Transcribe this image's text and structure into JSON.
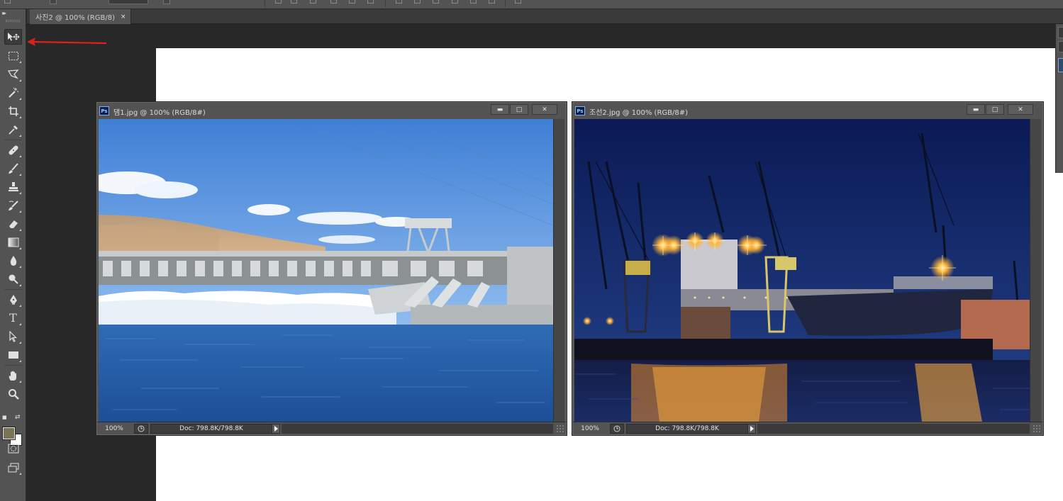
{
  "options_bar": {
    "icons": [
      "checkbox",
      "dropdown",
      "checkbox",
      "align-icons",
      "distribute-icons",
      "arrange-icon"
    ]
  },
  "toolbar": {
    "collapse_glyph": "▸▸",
    "tools": [
      {
        "name": "move-tool",
        "icon": "move-icon",
        "active": true
      },
      {
        "name": "marquee-tool",
        "icon": "rectangular-marquee-icon"
      },
      {
        "name": "lasso-tool",
        "icon": "polygonal-lasso-icon"
      },
      {
        "name": "magic-wand-tool",
        "icon": "magic-wand-icon"
      },
      {
        "name": "crop-tool",
        "icon": "crop-icon"
      },
      {
        "name": "eyedropper-tool",
        "icon": "eyedropper-icon"
      },
      {
        "name": "healing-brush-tool",
        "icon": "bandage-icon"
      },
      {
        "name": "brush-tool",
        "icon": "brush-icon"
      },
      {
        "name": "clone-stamp-tool",
        "icon": "stamp-icon"
      },
      {
        "name": "history-brush-tool",
        "icon": "history-brush-icon"
      },
      {
        "name": "eraser-tool",
        "icon": "eraser-icon"
      },
      {
        "name": "gradient-tool",
        "icon": "gradient-icon"
      },
      {
        "name": "blur-tool",
        "icon": "drop-icon"
      },
      {
        "name": "dodge-tool",
        "icon": "dodge-icon"
      },
      {
        "name": "pen-tool",
        "icon": "pen-icon"
      },
      {
        "name": "type-tool",
        "icon": "type-icon",
        "glyph": "T"
      },
      {
        "name": "path-selection-tool",
        "icon": "arrow-pointer-icon"
      },
      {
        "name": "shape-tool",
        "icon": "rectangle-shape-icon"
      },
      {
        "name": "hand-tool",
        "icon": "hand-icon"
      },
      {
        "name": "zoom-tool",
        "icon": "magnifier-icon"
      }
    ],
    "foreground_color": "#7a7455",
    "background_color": "#ffffff"
  },
  "tab": {
    "title": "사진2 @ 100% (RGB/8)",
    "close": "×"
  },
  "windows": [
    {
      "title": "댐1.jpg @ 100% (RGB/8#)",
      "badge": "Ps",
      "zoom": "100%",
      "doc": "Doc: 798.8K/798.8K",
      "min": "▬",
      "max": "□",
      "close": "✕",
      "image": "dam-spillway-photo"
    },
    {
      "title": "조선2.jpg @ 100% (RGB/8#)",
      "badge": "Ps",
      "zoom": "100%",
      "doc": "Doc: 798.8K/798.8K",
      "min": "▬",
      "max": "□",
      "close": "✕",
      "image": "shipyard-night-photo"
    }
  ],
  "annotation": {
    "color": "#e0201a",
    "shape": "arrow pointing to move tool"
  }
}
